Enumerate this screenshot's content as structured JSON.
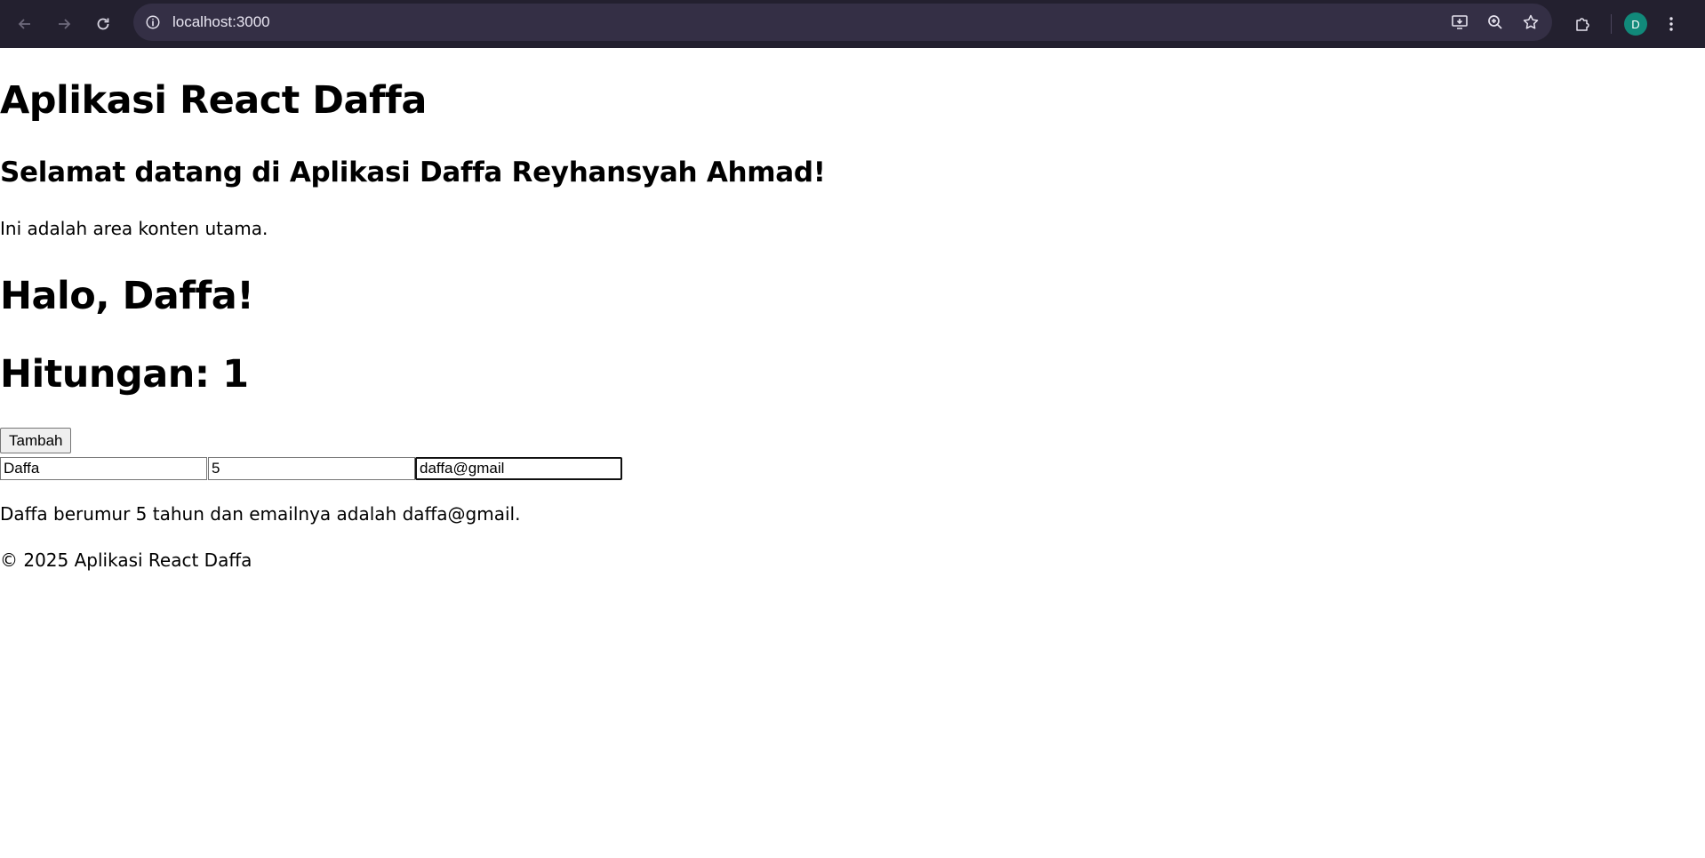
{
  "browser": {
    "url": "localhost:3000",
    "profile_initial": "D",
    "icons": [
      "back-arrow-icon",
      "forward-arrow-icon",
      "reload-icon",
      "site-info-icon",
      "install-app-icon",
      "zoom-icon",
      "bookmark-star-icon",
      "extensions-icon",
      "kebab-menu-icon"
    ]
  },
  "page": {
    "app_title": "Aplikasi React Daffa",
    "welcome": "Selamat datang di Aplikasi Daffa Reyhansyah Ahmad!",
    "main_text": "Ini adalah area konten utama.",
    "greeting": "Halo, Daffa!",
    "counter": "Hitungan: 1",
    "add_button": "Tambah",
    "inputs": {
      "name": "Daffa",
      "age": "5",
      "email": "daffa@gmail"
    },
    "summary": "Daffa berumur 5 tahun dan emailnya adalah daffa@gmail.",
    "footer": "© 2025 Aplikasi React Daffa"
  }
}
